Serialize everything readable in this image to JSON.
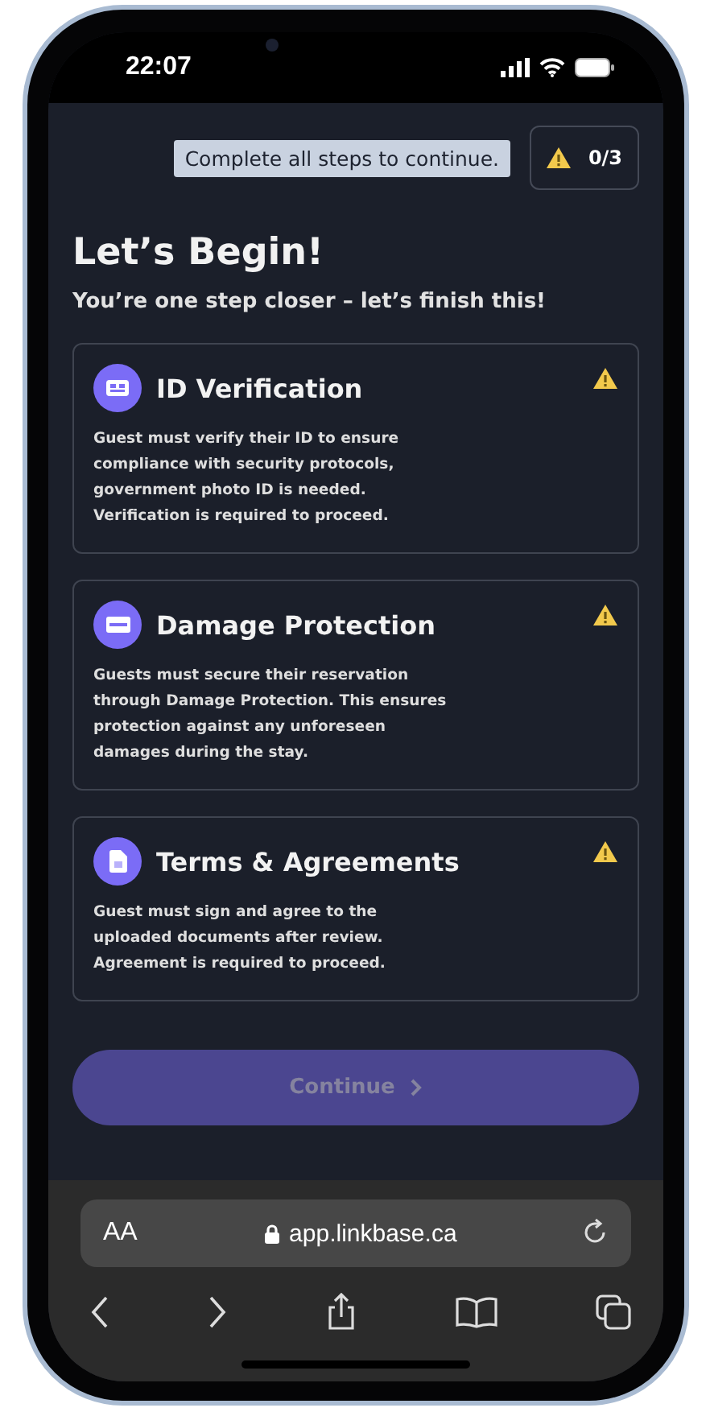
{
  "status_bar": {
    "time": "22:07"
  },
  "progress": {
    "tooltip": "Complete all steps to continue.",
    "count": "0/3"
  },
  "heading": "Let’s Begin!",
  "subtitle": "You’re one step closer – let’s finish this!",
  "steps": [
    {
      "title": "ID Verification",
      "description": "Guest must verify their ID to ensure compliance with security protocols, government photo ID is needed. Verification is required to proceed.",
      "completed": false
    },
    {
      "title": "Damage Protection",
      "description": "Guests must secure their reservation through Damage Protection. This ensures protection against any unforeseen damages during the stay.",
      "completed": false
    },
    {
      "title": "Terms & Agreements",
      "description": "Guest must sign and agree to the uploaded documents after review. Agreement is required to proceed.",
      "completed": false
    }
  ],
  "continue_button": {
    "label": "Continue",
    "disabled": true
  },
  "browser": {
    "text_size": "AA",
    "url": "app.linkbase.ca"
  }
}
